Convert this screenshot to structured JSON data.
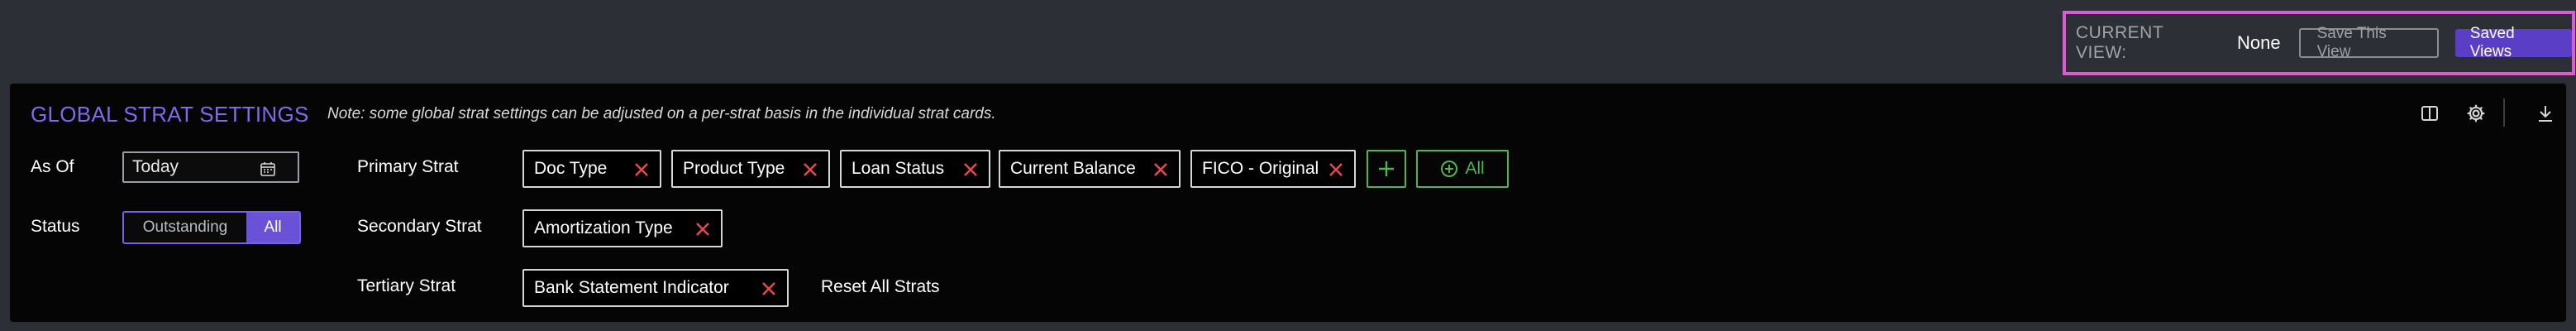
{
  "view_bar": {
    "current_view_label": "CURRENT VIEW:",
    "current_view_value": "None",
    "save_button": "Save This View",
    "saved_views_button": "Saved Views"
  },
  "panel": {
    "title": "GLOBAL STRAT SETTINGS",
    "note": "Note: some global strat settings can be adjusted on a per-strat basis in the individual strat cards.",
    "toolbar_icons": [
      "columns-icon",
      "gear-icon",
      "download-icon"
    ],
    "as_of": {
      "label": "As Of",
      "value": "Today"
    },
    "status": {
      "label": "Status",
      "options": [
        "Outstanding",
        "All"
      ],
      "selected": "All"
    },
    "primary": {
      "label": "Primary Strat",
      "chips": [
        "Doc Type",
        "Product Type",
        "Loan Status",
        "Current Balance",
        "FICO - Original"
      ],
      "all_button": "All"
    },
    "secondary": {
      "label": "Secondary Strat",
      "chips": [
        "Amortization Type"
      ]
    },
    "tertiary": {
      "label": "Tertiary Strat",
      "chips": [
        "Bank Statement Indicator"
      ]
    },
    "reset_label": "Reset All Strats"
  },
  "colors": {
    "accent_purple": "#8268ea",
    "highlight_border": "#d95cd2",
    "remove_red": "#e5484d",
    "add_green": "#4fb64f"
  }
}
